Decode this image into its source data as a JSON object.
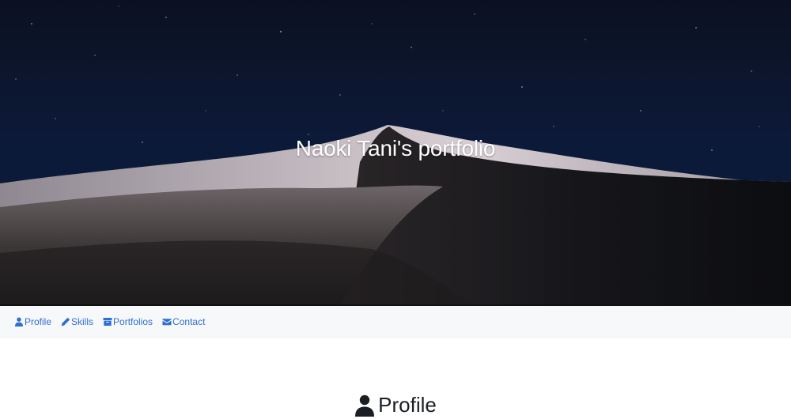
{
  "hero": {
    "title": "Naoki Tani's portfolio",
    "image_icon": "desert-dunes-night-image"
  },
  "nav": {
    "items": [
      {
        "label": "Profile",
        "icon": "user-icon"
      },
      {
        "label": "Skills",
        "icon": "pencil-icon"
      },
      {
        "label": "Portfolios",
        "icon": "archive-icon"
      },
      {
        "label": "Contact",
        "icon": "envelope-icon"
      }
    ],
    "link_color": "#2f6fd1",
    "background": "#f7f8fa"
  },
  "main": {
    "section_title": "Profile",
    "section_icon": "user-icon"
  }
}
